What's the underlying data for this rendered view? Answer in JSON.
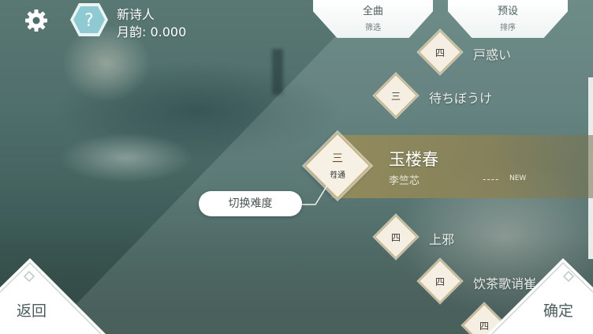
{
  "player": {
    "name": "新诗人",
    "rating": "月韵: 0.000"
  },
  "filters": [
    {
      "title": "全曲",
      "subtitle": "筛选"
    },
    {
      "title": "预设",
      "subtitle": "排序"
    }
  ],
  "songs": [
    {
      "difficulty": "四",
      "title": "戸惑い"
    },
    {
      "difficulty": "三",
      "title": "待ちぼうけ"
    },
    {
      "difficulty": "四",
      "title": "上邪"
    },
    {
      "difficulty": "四",
      "title": "饮茶歌诮崔"
    },
    {
      "difficulty": "四",
      "title": ""
    }
  ],
  "selected": {
    "difficulty": "三",
    "difficulty_name": "普通",
    "title": "玉楼春",
    "artist": "李竺芯",
    "score": "----",
    "badge": "NEW"
  },
  "buttons": {
    "switch_difficulty": "切换难度",
    "back": "返回",
    "confirm": "确定"
  },
  "colors": {
    "accent_gold": "#cbb78a",
    "selected_band": "#968c5a",
    "tab_text": "#4a5e5c"
  }
}
